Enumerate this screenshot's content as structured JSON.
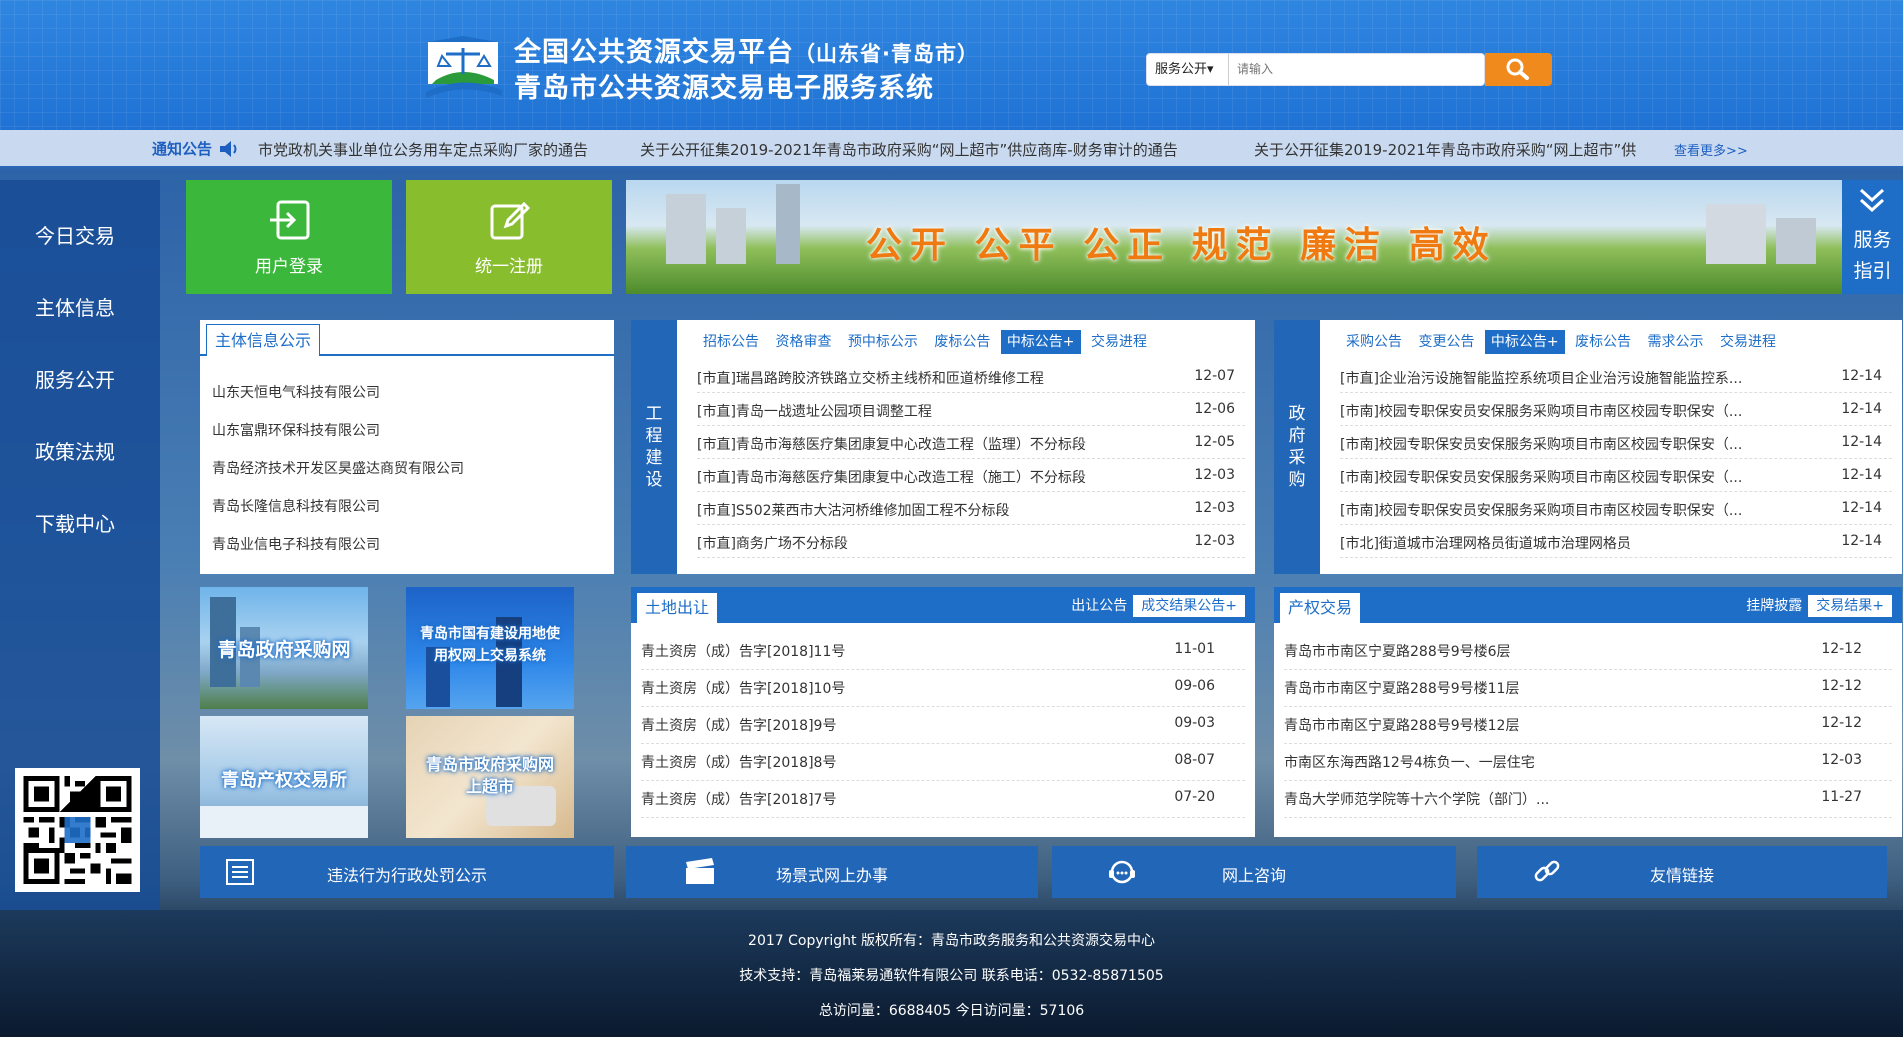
{
  "header": {
    "title_line1": "全国公共资源交易平台",
    "title_line1_sub": "（山东省·青岛市）",
    "title_line2": "青岛市公共资源交易电子服务系统",
    "search_select": "服务公开▾",
    "search_placeholder": "请输入"
  },
  "notice": {
    "label": "通知公告",
    "items": [
      "市党政机关事业单位公务用车定点采购厂家的通告",
      "关于公开征集2019-2021年青岛市政府采购“网上超市”供应商库-财务审计的通告",
      "关于公开征集2019-2021年青岛市政府采购“网上超市”供"
    ],
    "more": "查看更多>>"
  },
  "nav": {
    "items": [
      "今日交易",
      "主体信息",
      "服务公开",
      "政策法规",
      "下载中心"
    ]
  },
  "tiles": {
    "login": "用户登录",
    "register": "统一注册",
    "banner_text": "公开 公平 公正   规范 廉洁 高效",
    "guide": [
      "服务",
      "指引"
    ]
  },
  "subject_panel": {
    "title": "主体信息公示",
    "items": [
      "山东天恒电气科技有限公司",
      "山东富鼎环保科技有限公司",
      "青岛经济技术开发区昊盛达商贸有限公司",
      "青岛长隆信息科技有限公司",
      "青岛业信电子科技有限公司"
    ]
  },
  "engineering_panel": {
    "side_label": [
      "工",
      "程",
      "建",
      "设"
    ],
    "tabs": [
      "招标公告",
      "资格审查",
      "预中标公示",
      "废标公告",
      "中标公告+",
      "交易进程"
    ],
    "active_tab": 4,
    "rows": [
      {
        "title": "[市直]瑞昌路跨胶济铁路立交桥主线桥和匝道桥维修工程",
        "date": "12-07"
      },
      {
        "title": "[市直]青岛一战遗址公园项目调整工程",
        "date": "12-06"
      },
      {
        "title": "[市直]青岛市海慈医疗集团康复中心改造工程（监理）不分标段",
        "date": "12-05"
      },
      {
        "title": "[市直]青岛市海慈医疗集团康复中心改造工程（施工）不分标段",
        "date": "12-03"
      },
      {
        "title": "[市直]S502莱西市大沽河桥维修加固工程不分标段",
        "date": "12-03"
      },
      {
        "title": "[市直]商务广场不分标段",
        "date": "12-03"
      }
    ]
  },
  "procurement_panel": {
    "side_label": [
      "政",
      "府",
      "采",
      "购"
    ],
    "tabs": [
      "采购公告",
      "变更公告",
      "中标公告+",
      "废标公告",
      "需求公示",
      "交易进程"
    ],
    "active_tab": 2,
    "rows": [
      {
        "title": "[市直]企业治污设施智能监控系统项目企业治污设施智能监控系...",
        "date": "12-14"
      },
      {
        "title": "[市南]校园专职保安员安保服务采购项目市南区校园专职保安（...",
        "date": "12-14"
      },
      {
        "title": "[市南]校园专职保安员安保服务采购项目市南区校园专职保安（...",
        "date": "12-14"
      },
      {
        "title": "[市南]校园专职保安员安保服务采购项目市南区校园专职保安（...",
        "date": "12-14"
      },
      {
        "title": "[市南]校园专职保安员安保服务采购项目市南区校园专职保安（...",
        "date": "12-14"
      },
      {
        "title": "[市北]街道城市治理网格员街道城市治理网格员",
        "date": "12-14"
      }
    ]
  },
  "land_panel": {
    "title": "土地出让",
    "tab_label": "出让公告",
    "tab_button": "成交结果公告+",
    "rows": [
      {
        "title": "青土资房（成）告字[2018]11号",
        "date": "11-01"
      },
      {
        "title": "青土资房（成）告字[2018]10号",
        "date": "09-06"
      },
      {
        "title": "青土资房（成）告字[2018]9号",
        "date": "09-03"
      },
      {
        "title": "青土资房（成）告字[2018]8号",
        "date": "08-07"
      },
      {
        "title": "青土资房（成）告字[2018]7号",
        "date": "07-20"
      }
    ]
  },
  "property_panel": {
    "title": "产权交易",
    "tab_label": "挂牌披露",
    "tab_button": "交易结果+",
    "rows": [
      {
        "title": "青岛市市南区宁夏路288号9号楼6层",
        "date": "12-12"
      },
      {
        "title": "青岛市市南区宁夏路288号9号楼11层",
        "date": "12-12"
      },
      {
        "title": "青岛市市南区宁夏路288号9号楼12层",
        "date": "12-12"
      },
      {
        "title": "市南区东海西路12号4栋负一、一层住宅",
        "date": "12-03"
      },
      {
        "title": "青岛大学师范学院等十六个学院（部门）...",
        "date": "11-27"
      }
    ]
  },
  "platforms": [
    "青岛政府采购网",
    "青岛市国有建设用地使用权网上交易系统",
    "青岛产权交易所",
    "青岛市政府采购网上超市"
  ],
  "bottom_buttons": [
    "违法行为行政处罚公示",
    "场景式网上办事",
    "网上咨询",
    "友情链接"
  ],
  "footer": {
    "line1": "2017 Copyright 版权所有：青岛市政务服务和公共资源交易中心",
    "line2": "技术支持：青岛福莱易通软件有限公司 联系电话：0532-85871505",
    "line3": "总访问量：6688405 今日访问量：57106"
  },
  "colors": {
    "brand_blue": "#1e6ec8",
    "login_green": "#3bb83b",
    "register_green": "#88bd2e",
    "search_orange": "#f18a1c",
    "banner_text": "#f07a12"
  }
}
